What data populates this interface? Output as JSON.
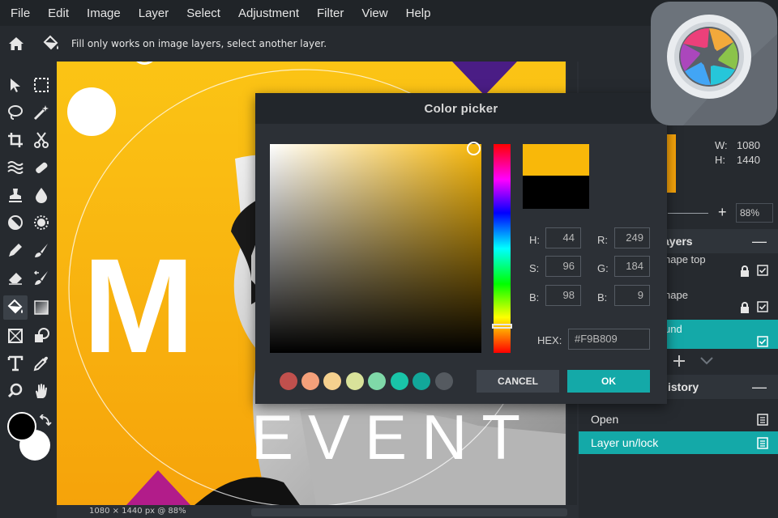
{
  "menu": [
    "File",
    "Edit",
    "Image",
    "Layer",
    "Select",
    "Adjustment",
    "Filter",
    "View",
    "Help"
  ],
  "options_bar": {
    "message": "Fill only works on image layers, select another layer."
  },
  "canvas": {
    "status": "1080 × 1440 px @ 88%",
    "art_letter": "M",
    "art_word": "EVENT"
  },
  "navigator": {
    "w_label": "W:",
    "w_value": "1080",
    "h_label": "H:",
    "h_value": "1440",
    "zoom": "88%",
    "plus": "+"
  },
  "layers": {
    "title": "ayers",
    "items": [
      {
        "name": "hape top"
      },
      {
        "name": "hape"
      },
      {
        "name": "und"
      }
    ]
  },
  "history": {
    "title": "istory",
    "items": [
      {
        "label": "Open"
      },
      {
        "label": "Layer un/lock"
      }
    ]
  },
  "color_picker": {
    "title": "Color picker",
    "close": "×",
    "h_label": "H:",
    "h_value": "44",
    "s_label": "S:",
    "s_value": "96",
    "b_label": "B:",
    "b_value": "98",
    "r_label": "R:",
    "r_value": "249",
    "g_label": "G:",
    "g_value": "184",
    "bl_label": "B:",
    "bl_value": "9",
    "hex_label": "HEX:",
    "hex_value": "#F9B809",
    "cancel": "CANCEL",
    "ok": "OK",
    "selected_color": "#F9B809",
    "previous_color": "#000000",
    "swatches": [
      "#c0504d",
      "#f4a07a",
      "#f5d08e",
      "#d9e29a",
      "#7fd8a8",
      "#19c4a8",
      "#12a79a",
      "#555a60"
    ]
  },
  "colors": {
    "accent": "#14a9a8",
    "fg_color": "#000000",
    "bg_color": "#ffffff"
  }
}
